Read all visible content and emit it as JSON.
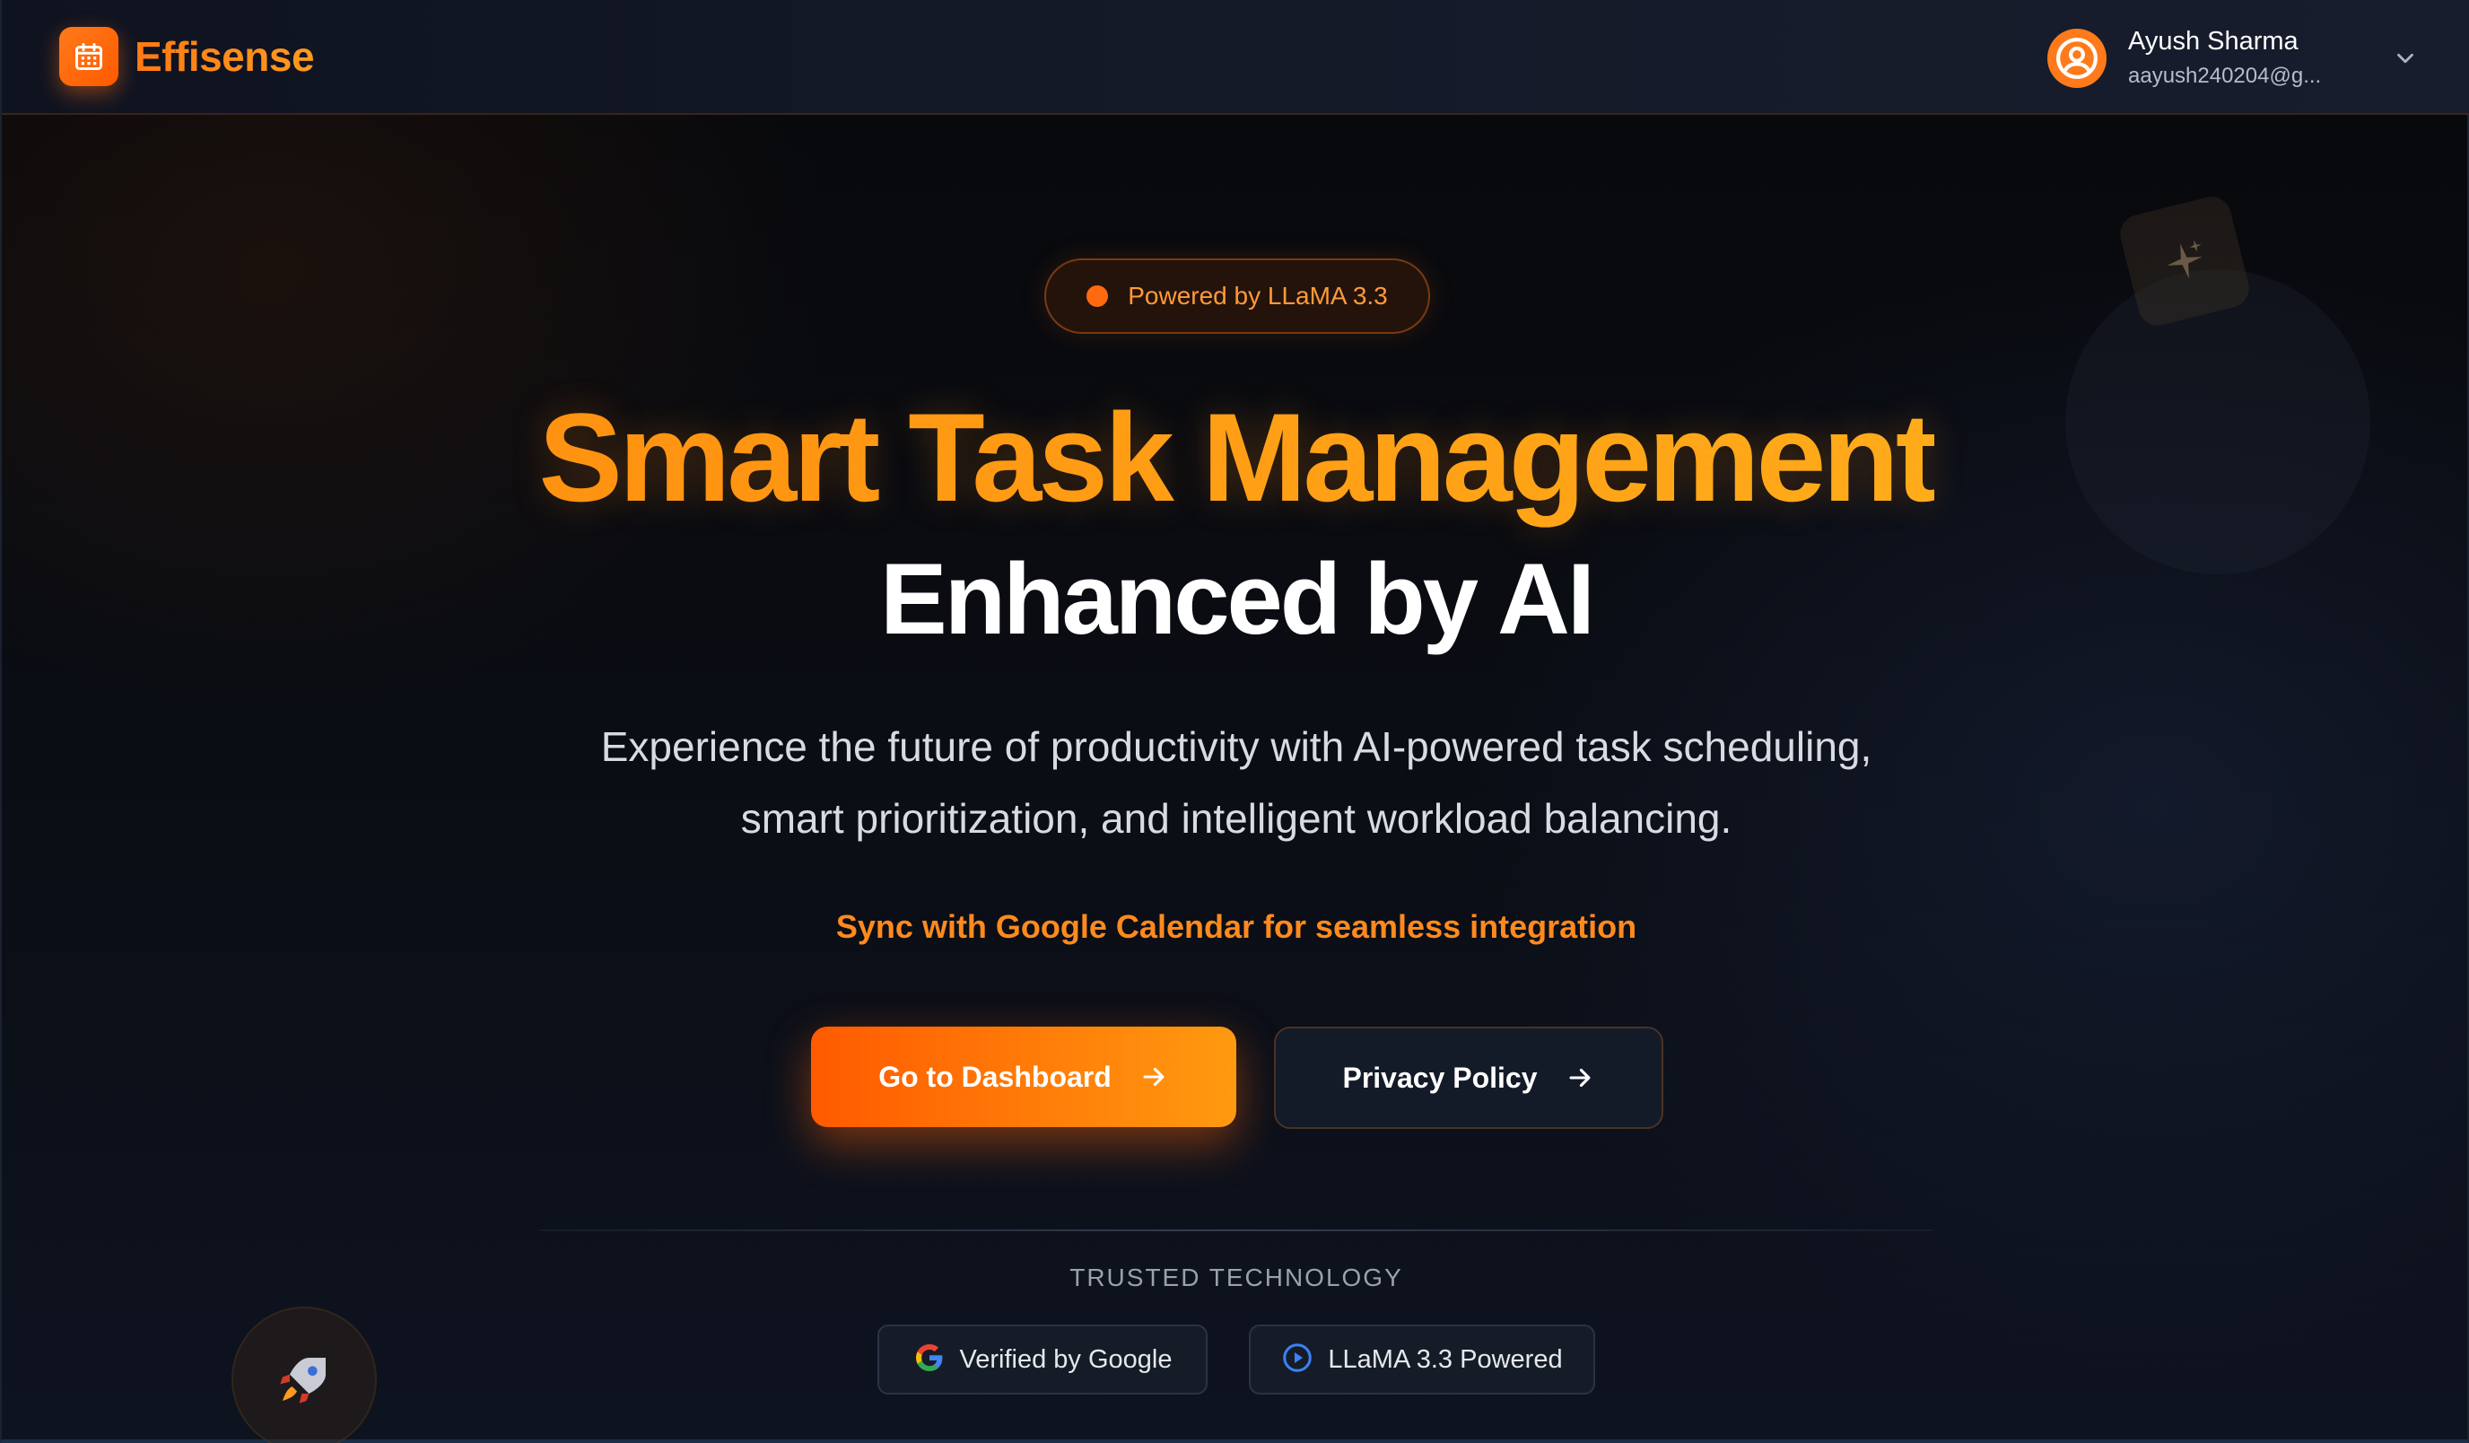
{
  "header": {
    "brand_name": "Effisense",
    "brand_icon": "calendar-icon",
    "user_name": "Ayush Sharma",
    "user_email": "aayush240204@g...",
    "avatar_icon": "user-circle-icon",
    "menu_icon": "chevron-down-icon"
  },
  "hero": {
    "badge_text": "Powered by LLaMA 3.3",
    "title_line1": "Smart Task Management",
    "title_line2": "Enhanced by AI",
    "subtitle_line1": "Experience the future of productivity with AI-powered task scheduling,",
    "subtitle_line2": "smart prioritization, and intelligent workload balancing.",
    "sync_text": "Sync with Google Calendar for seamless integration",
    "primary_button": "Go to Dashboard",
    "secondary_button": "Privacy Policy"
  },
  "trusted": {
    "heading": "TRUSTED TECHNOLOGY",
    "badges": [
      {
        "label": "Verified by Google",
        "icon": "google-icon"
      },
      {
        "label": "LLaMA 3.3 Powered",
        "icon": "play-circle-icon"
      }
    ]
  },
  "colors": {
    "accent": "#ff7a1a",
    "accent_gradient_start": "#ff5a00",
    "accent_gradient_end": "#ffa51a",
    "background": "#0b0d12"
  }
}
